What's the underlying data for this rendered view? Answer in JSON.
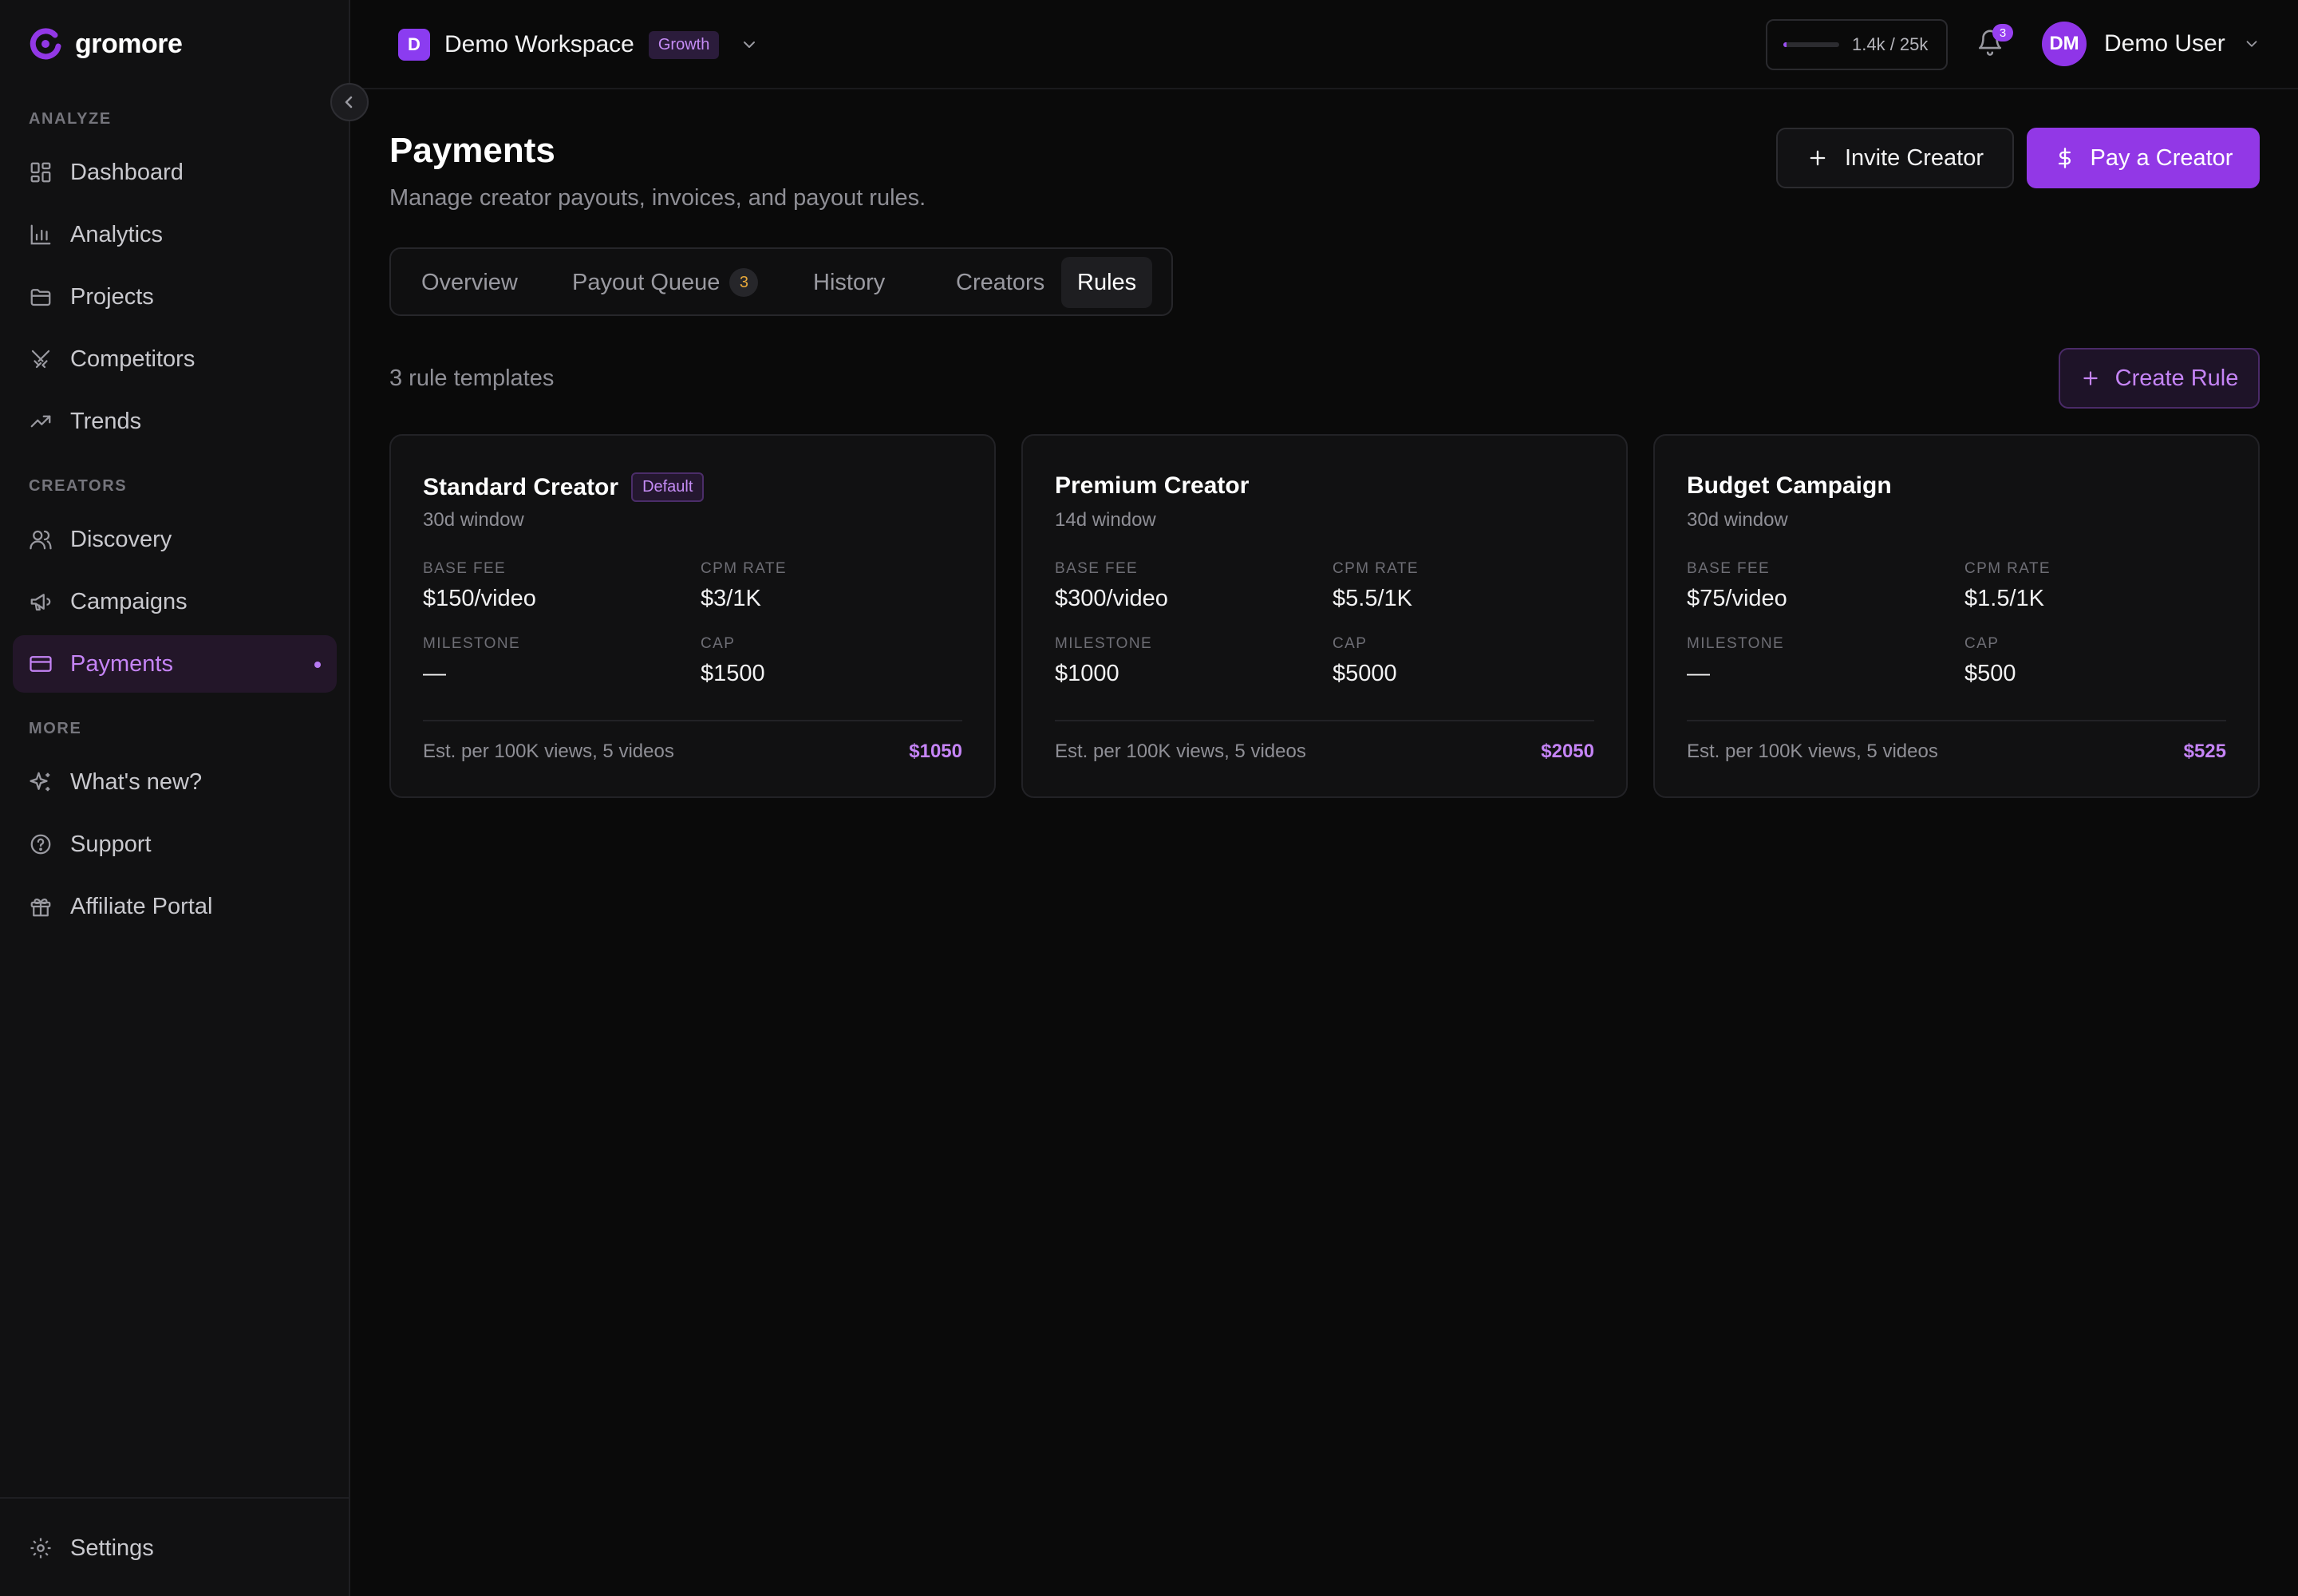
{
  "app": {
    "name": "gromore"
  },
  "sidebar": {
    "sections": [
      {
        "label": "ANALYZE",
        "items": [
          {
            "label": "Dashboard",
            "icon": "dashboard-icon"
          },
          {
            "label": "Analytics",
            "icon": "bar-chart-icon"
          },
          {
            "label": "Projects",
            "icon": "folder-icon"
          },
          {
            "label": "Competitors",
            "icon": "swords-icon"
          },
          {
            "label": "Trends",
            "icon": "trending-up-icon"
          }
        ]
      },
      {
        "label": "CREATORS",
        "items": [
          {
            "label": "Discovery",
            "icon": "users-icon"
          },
          {
            "label": "Campaigns",
            "icon": "megaphone-icon"
          },
          {
            "label": "Payments",
            "icon": "credit-card-icon",
            "active": true
          }
        ]
      },
      {
        "label": "MORE",
        "items": [
          {
            "label": "What's new?",
            "icon": "sparkles-icon"
          },
          {
            "label": "Support",
            "icon": "help-circle-icon"
          },
          {
            "label": "Affiliate Portal",
            "icon": "gift-icon"
          }
        ]
      }
    ],
    "footer": {
      "settings_label": "Settings"
    }
  },
  "topbar": {
    "workspace": {
      "initial": "D",
      "name": "Demo Workspace",
      "plan": "Growth"
    },
    "usage": {
      "text": "1.4k / 25k",
      "used": 1400,
      "limit": 25000
    },
    "notifications": {
      "count": "3"
    },
    "user": {
      "initials": "DM",
      "name": "Demo User"
    }
  },
  "page": {
    "title": "Payments",
    "subtitle": "Manage creator payouts, invoices, and payout rules.",
    "invite_label": "Invite Creator",
    "pay_label": "Pay a Creator"
  },
  "tabs": [
    {
      "label": "Overview"
    },
    {
      "label": "Payout Queue",
      "count": "3"
    },
    {
      "label": "History"
    },
    {
      "label": "Creators"
    },
    {
      "label": "Rules",
      "active": true
    }
  ],
  "rules": {
    "count_text": "3 rule templates",
    "create_label": "Create Rule",
    "field_labels": {
      "base_fee": "BASE FEE",
      "cpm_rate": "CPM RATE",
      "milestone": "MILESTONE",
      "cap": "CAP"
    },
    "cards": [
      {
        "name": "Standard Creator",
        "badge": "Default",
        "window": "30d window",
        "base_fee": "$150/video",
        "cpm_rate": "$3/1K",
        "milestone": "—",
        "cap": "$1500",
        "estimate_label": "Est. per 100K views, 5 videos",
        "estimate_value": "$1050"
      },
      {
        "name": "Premium Creator",
        "window": "14d window",
        "base_fee": "$300/video",
        "cpm_rate": "$5.5/1K",
        "milestone": "$1000",
        "cap": "$5000",
        "estimate_label": "Est. per 100K views, 5 videos",
        "estimate_value": "$2050"
      },
      {
        "name": "Budget Campaign",
        "window": "30d window",
        "base_fee": "$75/video",
        "cpm_rate": "$1.5/1K",
        "milestone": "—",
        "cap": "$500",
        "estimate_label": "Est. per 100K views, 5 videos",
        "estimate_value": "$525"
      }
    ]
  },
  "colors": {
    "accent": "#9238e6",
    "accent_text": "#c584f6",
    "background": "#0a0a0a",
    "sidebar": "#111112"
  }
}
